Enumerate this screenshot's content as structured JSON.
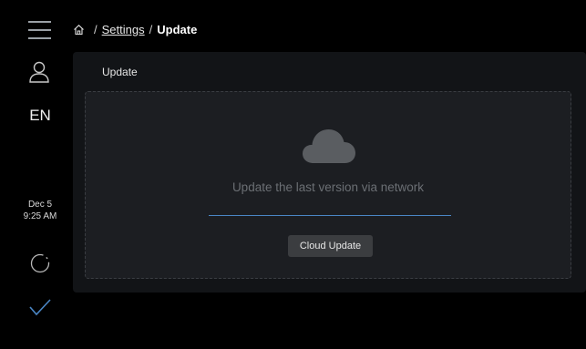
{
  "sidebar": {
    "language": "EN",
    "date": "Dec 5",
    "time": "9:25 AM"
  },
  "breadcrumb": {
    "separator": "/",
    "settings": "Settings",
    "current": "Update"
  },
  "panel": {
    "title": "Update",
    "message": "Update the last version via network",
    "button_label": "Cloud Update"
  },
  "colors": {
    "background": "#000000",
    "panel": "#121417",
    "dropzone": "#1c1e22",
    "accent_line": "#4a86c5",
    "button": "#3b3d40"
  },
  "icons": [
    "hamburger-menu-icon",
    "user-icon",
    "spinner-icon",
    "check-icon",
    "home-icon",
    "cloud-icon"
  ]
}
